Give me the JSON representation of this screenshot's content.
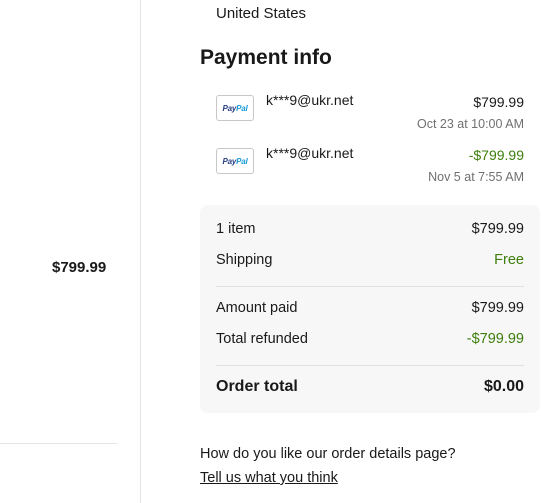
{
  "left": {
    "price": "$799.99"
  },
  "shipping_address": {
    "country": "United States"
  },
  "payment_info": {
    "title": "Payment info",
    "payments": [
      {
        "method": "PayPal",
        "email": "k***9@ukr.net",
        "amount": "$799.99",
        "date": "Oct 23 at 10:00 AM",
        "is_refund": false
      },
      {
        "method": "PayPal",
        "email": "k***9@ukr.net",
        "amount": "-$799.99",
        "date": "Nov 5 at 7:55 AM",
        "is_refund": true
      }
    ]
  },
  "summary": {
    "items_label": "1 item",
    "items_value": "$799.99",
    "shipping_label": "Shipping",
    "shipping_value": "Free",
    "amount_paid_label": "Amount paid",
    "amount_paid_value": "$799.99",
    "refunded_label": "Total refunded",
    "refunded_value": "-$799.99",
    "order_total_label": "Order total",
    "order_total_value": "$0.00"
  },
  "feedback": {
    "question": "How do you like our order details page?",
    "link": "Tell us what you think"
  },
  "colors": {
    "refund_green": "#3d7e0c",
    "summary_bg": "#f7f7f7",
    "muted_text": "#707070"
  }
}
